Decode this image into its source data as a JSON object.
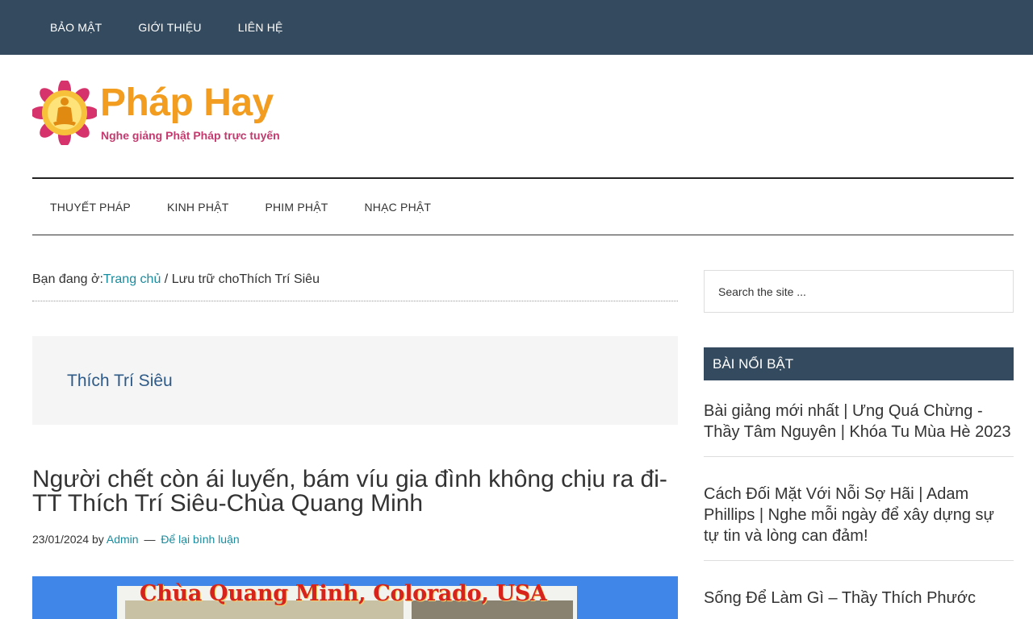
{
  "top_nav": {
    "items": [
      "BẢO MẬT",
      "GIỚI THIỆU",
      "LIÊN HỆ"
    ]
  },
  "header": {
    "site_title": "Pháp Hay",
    "tagline": "Nghe giảng Phật Pháp trực tuyến"
  },
  "main_nav": {
    "items": [
      "THUYẾT PHÁP",
      "KINH PHẬT",
      "PHIM PHẬT",
      "NHẠC PHẬT"
    ]
  },
  "breadcrumb": {
    "prefix": "Bạn đang ở:",
    "home": "Trang chủ",
    "separator": " / ",
    "archive_prefix": "Lưu trữ cho",
    "current": "Thích Trí Siêu"
  },
  "archive": {
    "title": "Thích Trí Siêu"
  },
  "post": {
    "title": "Người chết còn ái luyến, bám víu gia đình không chịu ra đi-TT Thích Trí Siêu-Chùa Quang Minh",
    "date": "23/01/2024",
    "by": "by",
    "author": "Admin",
    "dash": "—",
    "comment_link": "Để lại bình luận",
    "image_caption": "Chùa Quang Minh, Colorado, USA"
  },
  "sidebar": {
    "search_placeholder": "Search the site ...",
    "widget_title": "BÀI NỔI BẬT",
    "featured": [
      "Bài giảng mới nhất | Ưng Quá Chừng - Thầy Tâm Nguyên | Khóa Tu Mùa Hè 2023",
      "Cách Đối Mặt Với Nỗi Sợ Hãi | Adam Phillips | Nghe mỗi ngày để xây dựng sự tự tin và lòng can đảm!",
      "Sống Để Làm Gì – Thầy Thích Phước"
    ]
  },
  "colors": {
    "header_bg": "#344b5f",
    "logo_orange": "#f29d1f",
    "tagline_pink": "#c43a6e",
    "link_teal": "#1a8c9e",
    "archive_title_blue": "#2e5a87"
  }
}
